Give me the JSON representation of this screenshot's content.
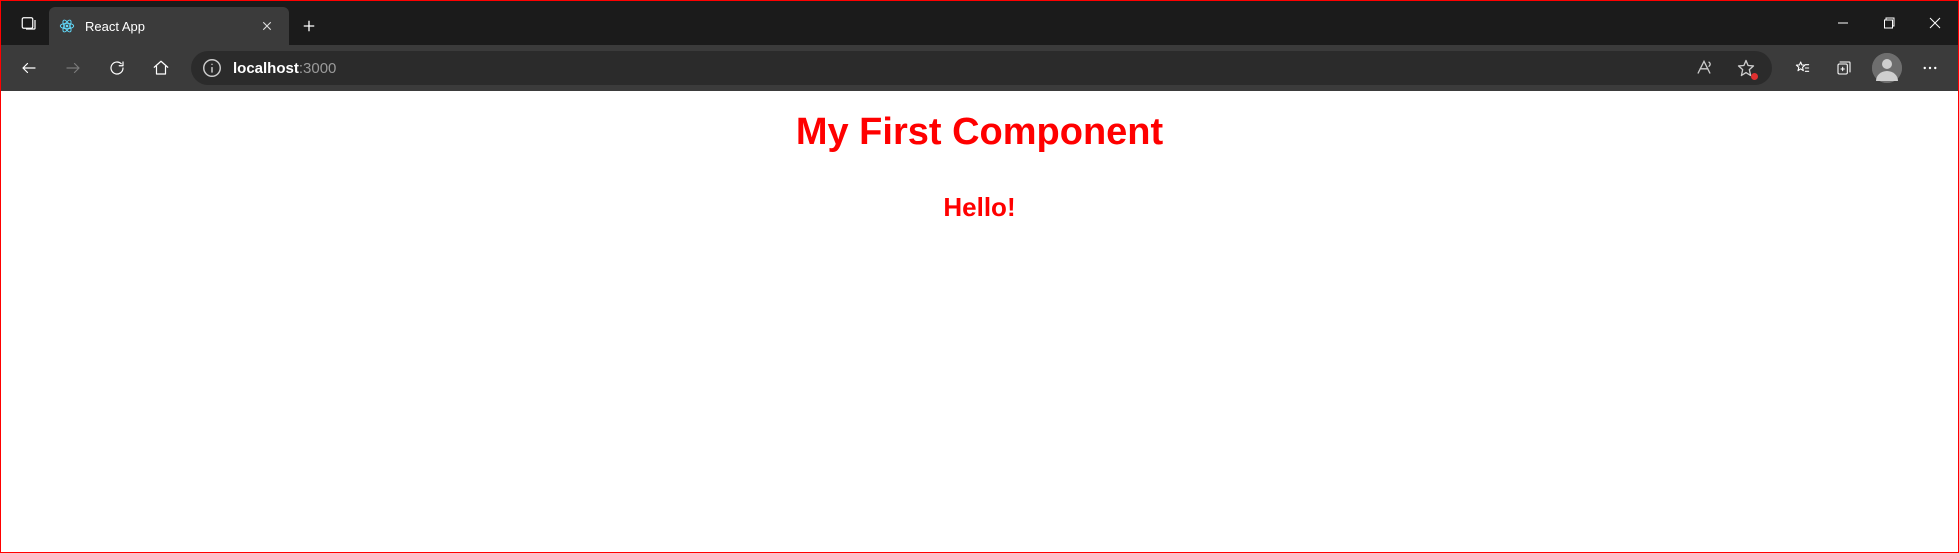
{
  "tab": {
    "title": "React App"
  },
  "address": {
    "host": "localhost",
    "port": ":3000"
  },
  "page": {
    "heading": "My First Component",
    "subheading": "Hello!"
  }
}
